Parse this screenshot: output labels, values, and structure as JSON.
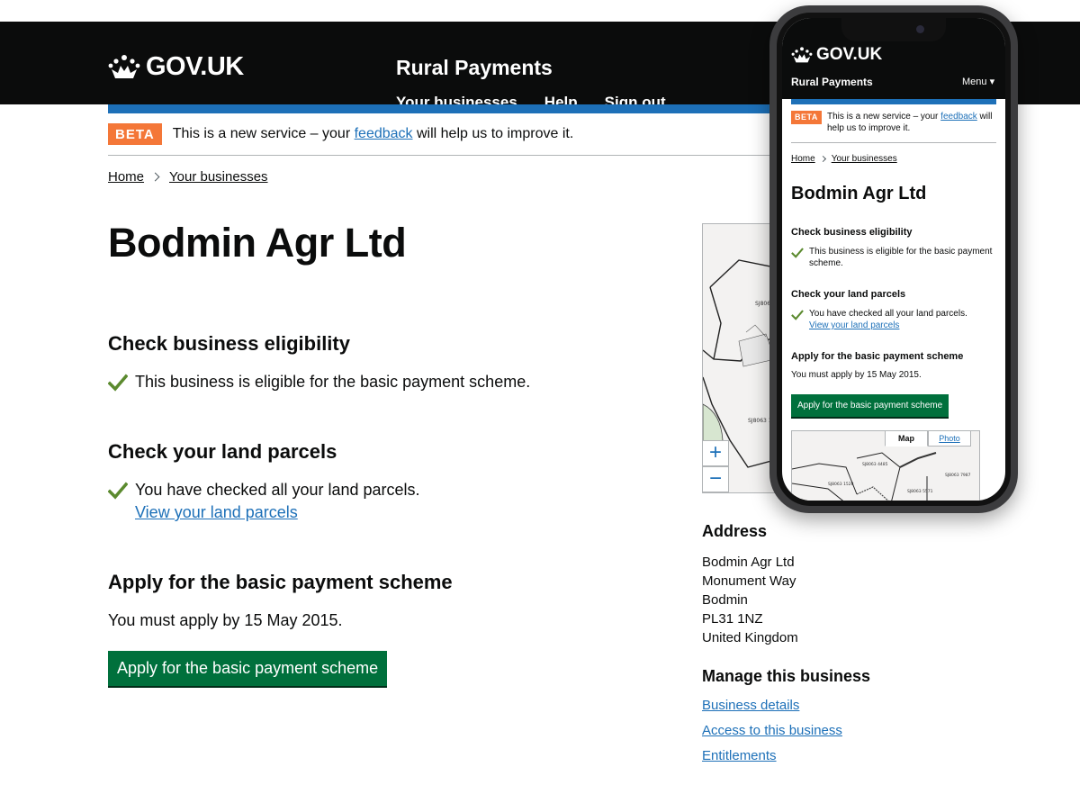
{
  "header": {
    "logo_text": "GOV.UK",
    "service_name": "Rural Payments",
    "nav": [
      "Your businesses",
      "Help",
      "Sign out"
    ]
  },
  "phase_banner": {
    "tag": "BETA",
    "text_before": "This is a new service – your",
    "link": "feedback",
    "text_after": "will help us to improve it."
  },
  "breadcrumbs": [
    "Home",
    "Your businesses"
  ],
  "page_title": "Bodmin Agr Ltd",
  "eligibility": {
    "heading": "Check business eligibility",
    "status": "This business is eligible for the basic payment scheme."
  },
  "parcels": {
    "heading": "Check your land parcels",
    "status": "You have checked all your land parcels.",
    "link": "View your land parcels"
  },
  "apply": {
    "heading": "Apply for the basic payment scheme",
    "deadline": "You must apply by 15 May 2015.",
    "button": "Apply for the basic payment scheme"
  },
  "map": {
    "zoom_in": "+",
    "zoom_out": "−",
    "parcel_labels": [
      "SJ8063 1039",
      "SJ806 1678"
    ],
    "tabs": [
      "Map",
      "Photo"
    ],
    "mobile_parcel_labels": [
      "SJ8063 4485",
      "SJ8063 1528",
      "SJ8063 7987",
      "SJ8063 5571"
    ]
  },
  "address": {
    "heading": "Address",
    "lines": [
      "Bodmin Agr Ltd",
      "Monument Way",
      "Bodmin",
      "PL31 1NZ",
      "United Kingdom"
    ]
  },
  "manage": {
    "heading": "Manage this business",
    "links": [
      "Business details",
      "Access to this business",
      "Entitlements"
    ]
  },
  "mobile": {
    "menu": "Menu ▾"
  },
  "colors": {
    "header_bg": "#0b0c0c",
    "brand_blue": "#1d70b8",
    "beta_orange": "#f47738",
    "button_green": "#00703c",
    "tick_green": "#5b8a2e"
  }
}
